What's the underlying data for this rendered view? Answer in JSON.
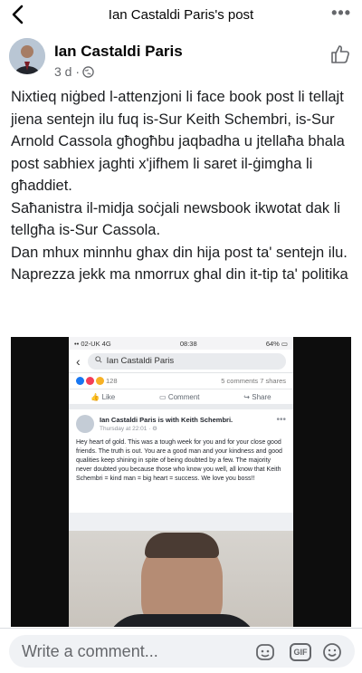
{
  "topbar": {
    "title": "Ian Castaldi Paris's post"
  },
  "post": {
    "author": "Ian Castaldi Paris",
    "time": "3 d ·",
    "paragraphs": [
      "Nixtieq niġbed l-attenzjoni li face book post li tellajt jiena sentejn ilu fuq is-Sur Keith Schembri, is-Sur Arnold Cassola   għogħbu jaqbadha u jtellaħa bhala post sabhiex jaghti x'jifhem li saret il-ġimgha li għaddiet.",
      "Saħanistra il-midja soċjali newsbook ikwotat dak li tellgħa is-Sur Cassola.",
      "Dan mhux minnhu ghax din hija post ta' sentejn ilu.",
      "Naprezza jekk ma nmorrux ghal din it-tip ta' politika"
    ]
  },
  "screenshot": {
    "status_left": "•• 02-UK  4G",
    "status_time": "08:38",
    "status_right": "64% ▭",
    "search_text": "Ian Castaldi Paris",
    "reaction_count": "128",
    "counts": "5 comments  7 shares",
    "like": "Like",
    "comment": "Comment",
    "share": "Share",
    "author_line": "Ian Castaldi Paris is with Keith Schembri.",
    "time": "Thursday at 22:01 · ⚙",
    "text": "Hey heart of gold. This was a tough week for you and for your close good friends. The truth is out.  You are a good man and your kindness and good qualities keep shining in spite of being doubted by a few. The majority never doubted you because those who know you well, all know that Keith Schembri = kind man = big heart = success. We love you boss!!"
  },
  "comment_bar": {
    "placeholder": "Write a comment...",
    "gif_label": "GIF"
  },
  "colors": {
    "muted": "#65676b",
    "input_bg": "#f0f2f5",
    "like_blue": "#1877f2"
  }
}
